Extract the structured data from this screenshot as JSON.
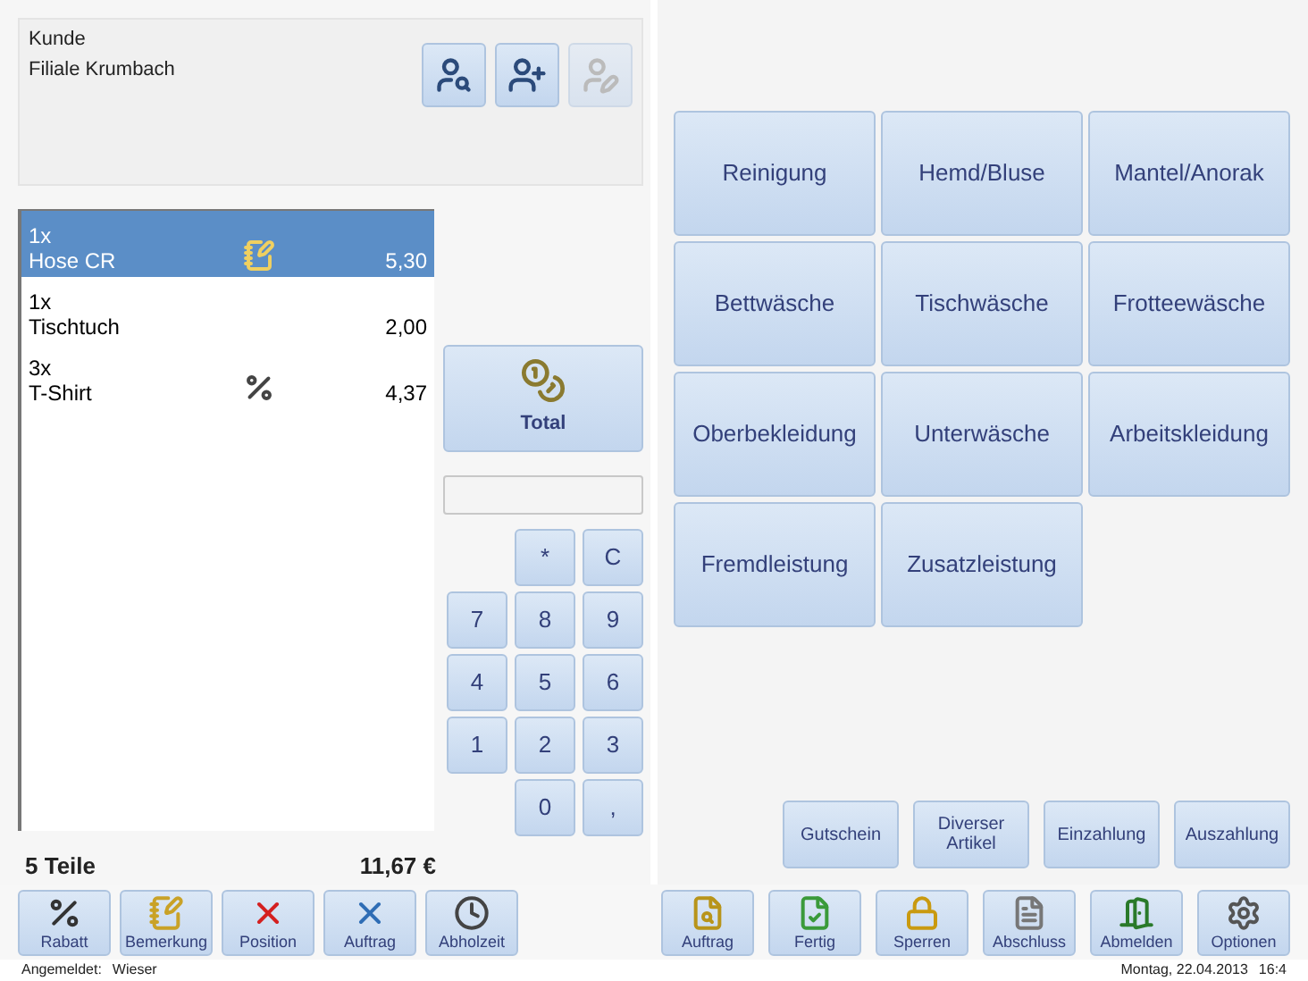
{
  "customer": {
    "label": "Kunde",
    "name": "Filiale Krumbach",
    "buttons": [
      {
        "kind": "search",
        "disabled": false
      },
      {
        "kind": "add",
        "disabled": false
      },
      {
        "kind": "edit",
        "disabled": true
      }
    ]
  },
  "order": {
    "items": [
      {
        "qty": "1x",
        "name": "Hose CR",
        "kind": "note",
        "price": "5,30",
        "selected": true
      },
      {
        "qty": "1x",
        "name": "Tischtuch",
        "kind": "plain",
        "price": "2,00",
        "selected": false
      },
      {
        "qty": "3x",
        "name": "T-Shirt",
        "kind": "discount",
        "price": "4,37",
        "selected": false
      }
    ],
    "count": "5 Teile",
    "total": "11,67 €"
  },
  "total_button": "Total",
  "keypad": [
    [
      "*",
      "C"
    ],
    [
      "7",
      "8",
      "9"
    ],
    [
      "4",
      "5",
      "6"
    ],
    [
      "1",
      "2",
      "3"
    ],
    [
      "0",
      ","
    ]
  ],
  "categories": [
    "Reinigung",
    "Hemd/Bluse",
    "Mantel/Anorak",
    "Bettwäsche",
    "Tischwäsche",
    "Frotteewäsche",
    "Oberbekleidung",
    "Unterwäsche",
    "Arbeitskleidung",
    "Fremdleistung",
    "Zusatzleistung"
  ],
  "actions": [
    "Gutschein",
    "Diverser Artikel",
    "Einzahlung",
    "Auszahlung"
  ],
  "toolbar_left": [
    {
      "kind": "discount",
      "label": "Rabatt"
    },
    {
      "kind": "note",
      "label": "Bemerkung"
    },
    {
      "kind": "delete",
      "label": "Position"
    },
    {
      "kind": "cancel",
      "label": "Auftrag"
    },
    {
      "kind": "clock",
      "label": "Abholzeit"
    }
  ],
  "toolbar_right": [
    {
      "kind": "find",
      "label": "Auftrag"
    },
    {
      "kind": "done",
      "label": "Fertig"
    },
    {
      "kind": "lock",
      "label": "Sperren"
    },
    {
      "kind": "document",
      "label": "Abschluss"
    },
    {
      "kind": "logout",
      "label": "Abmelden"
    },
    {
      "kind": "settings",
      "label": "Optionen"
    }
  ],
  "status_bar": {
    "user_label": "Angemeldet:",
    "user": "Wieser",
    "date": "Montag, 22.04.2013",
    "time": "16:4"
  }
}
